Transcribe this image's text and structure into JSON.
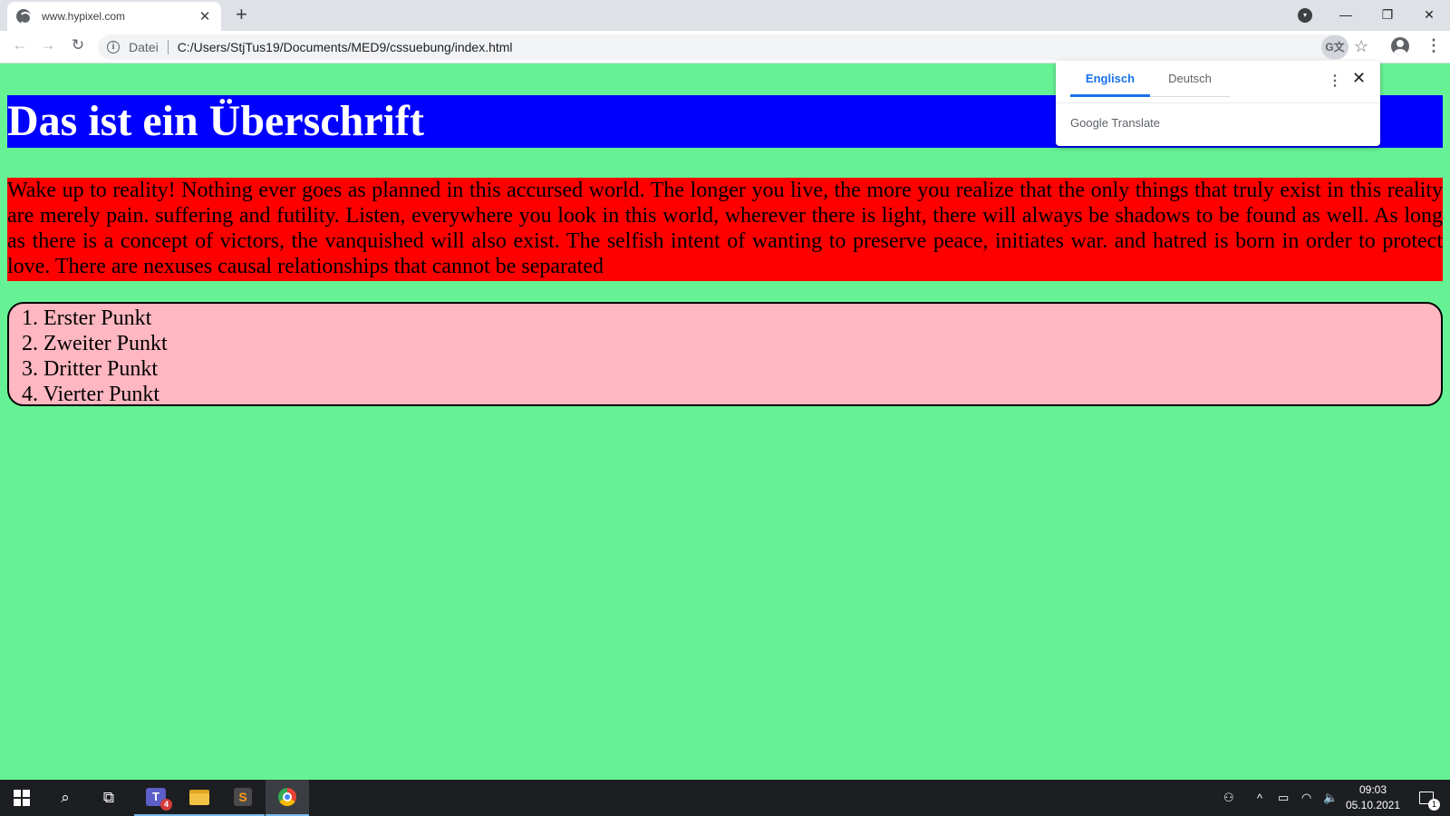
{
  "browser": {
    "tab_title": "www.hypixel.com",
    "tab_close": "✕",
    "new_tab": "+",
    "window_controls": {
      "minimize": "—",
      "restore": "❐",
      "close": "✕"
    },
    "nav": {
      "back": "←",
      "forward": "→",
      "reload": "↻"
    },
    "address": {
      "scheme_label": "Datei",
      "url": "C:/Users/StjTus19/Documents/MED9/cssuebung/index.html"
    },
    "icons": {
      "translate": "G文",
      "star": "☆",
      "menu": "⋮"
    }
  },
  "page": {
    "heading": "Das ist ein Überschrift",
    "paragraph": "Wake up to reality! Nothing ever goes as planned in this accursed world. The longer you live, the more you realize that the only things that truly exist in this reality are merely pain. suffering and futility. Listen, everywhere you look in this world, wherever there is light, there will always be shadows to be found as well. As long as there is a concept of victors, the vanquished will also exist. The selfish intent of wanting to preserve peace, initiates war. and hatred is born in order to protect love. There are nexuses causal relationships that cannot be separated",
    "list": [
      "1. Erster Punkt",
      "2. Zweiter Punkt",
      "3. Dritter Punkt",
      "4. Vierter Punkt"
    ],
    "colors": {
      "background": "#66f294",
      "heading_bg": "#0000ff",
      "paragraph_bg": "#ff0000",
      "list_bg": "#ffb7c2"
    }
  },
  "translate_popup": {
    "tab_active": "Englisch",
    "tab_other": "Deutsch",
    "more": "⋮",
    "close": "✕",
    "brand_google": "Google",
    "brand_translate": "Translate"
  },
  "taskbar": {
    "teams_badge": "4",
    "teams_letter": "T",
    "sublime_letter": "S",
    "clock_time": "09:03",
    "clock_date": "05.10.2021",
    "notification_count": "1",
    "icons": {
      "search": "⌕",
      "taskview": "⧉",
      "people": "⚇",
      "chevron_up": "^",
      "battery": "▭",
      "wifi": "◠",
      "volume": "🔈"
    }
  }
}
